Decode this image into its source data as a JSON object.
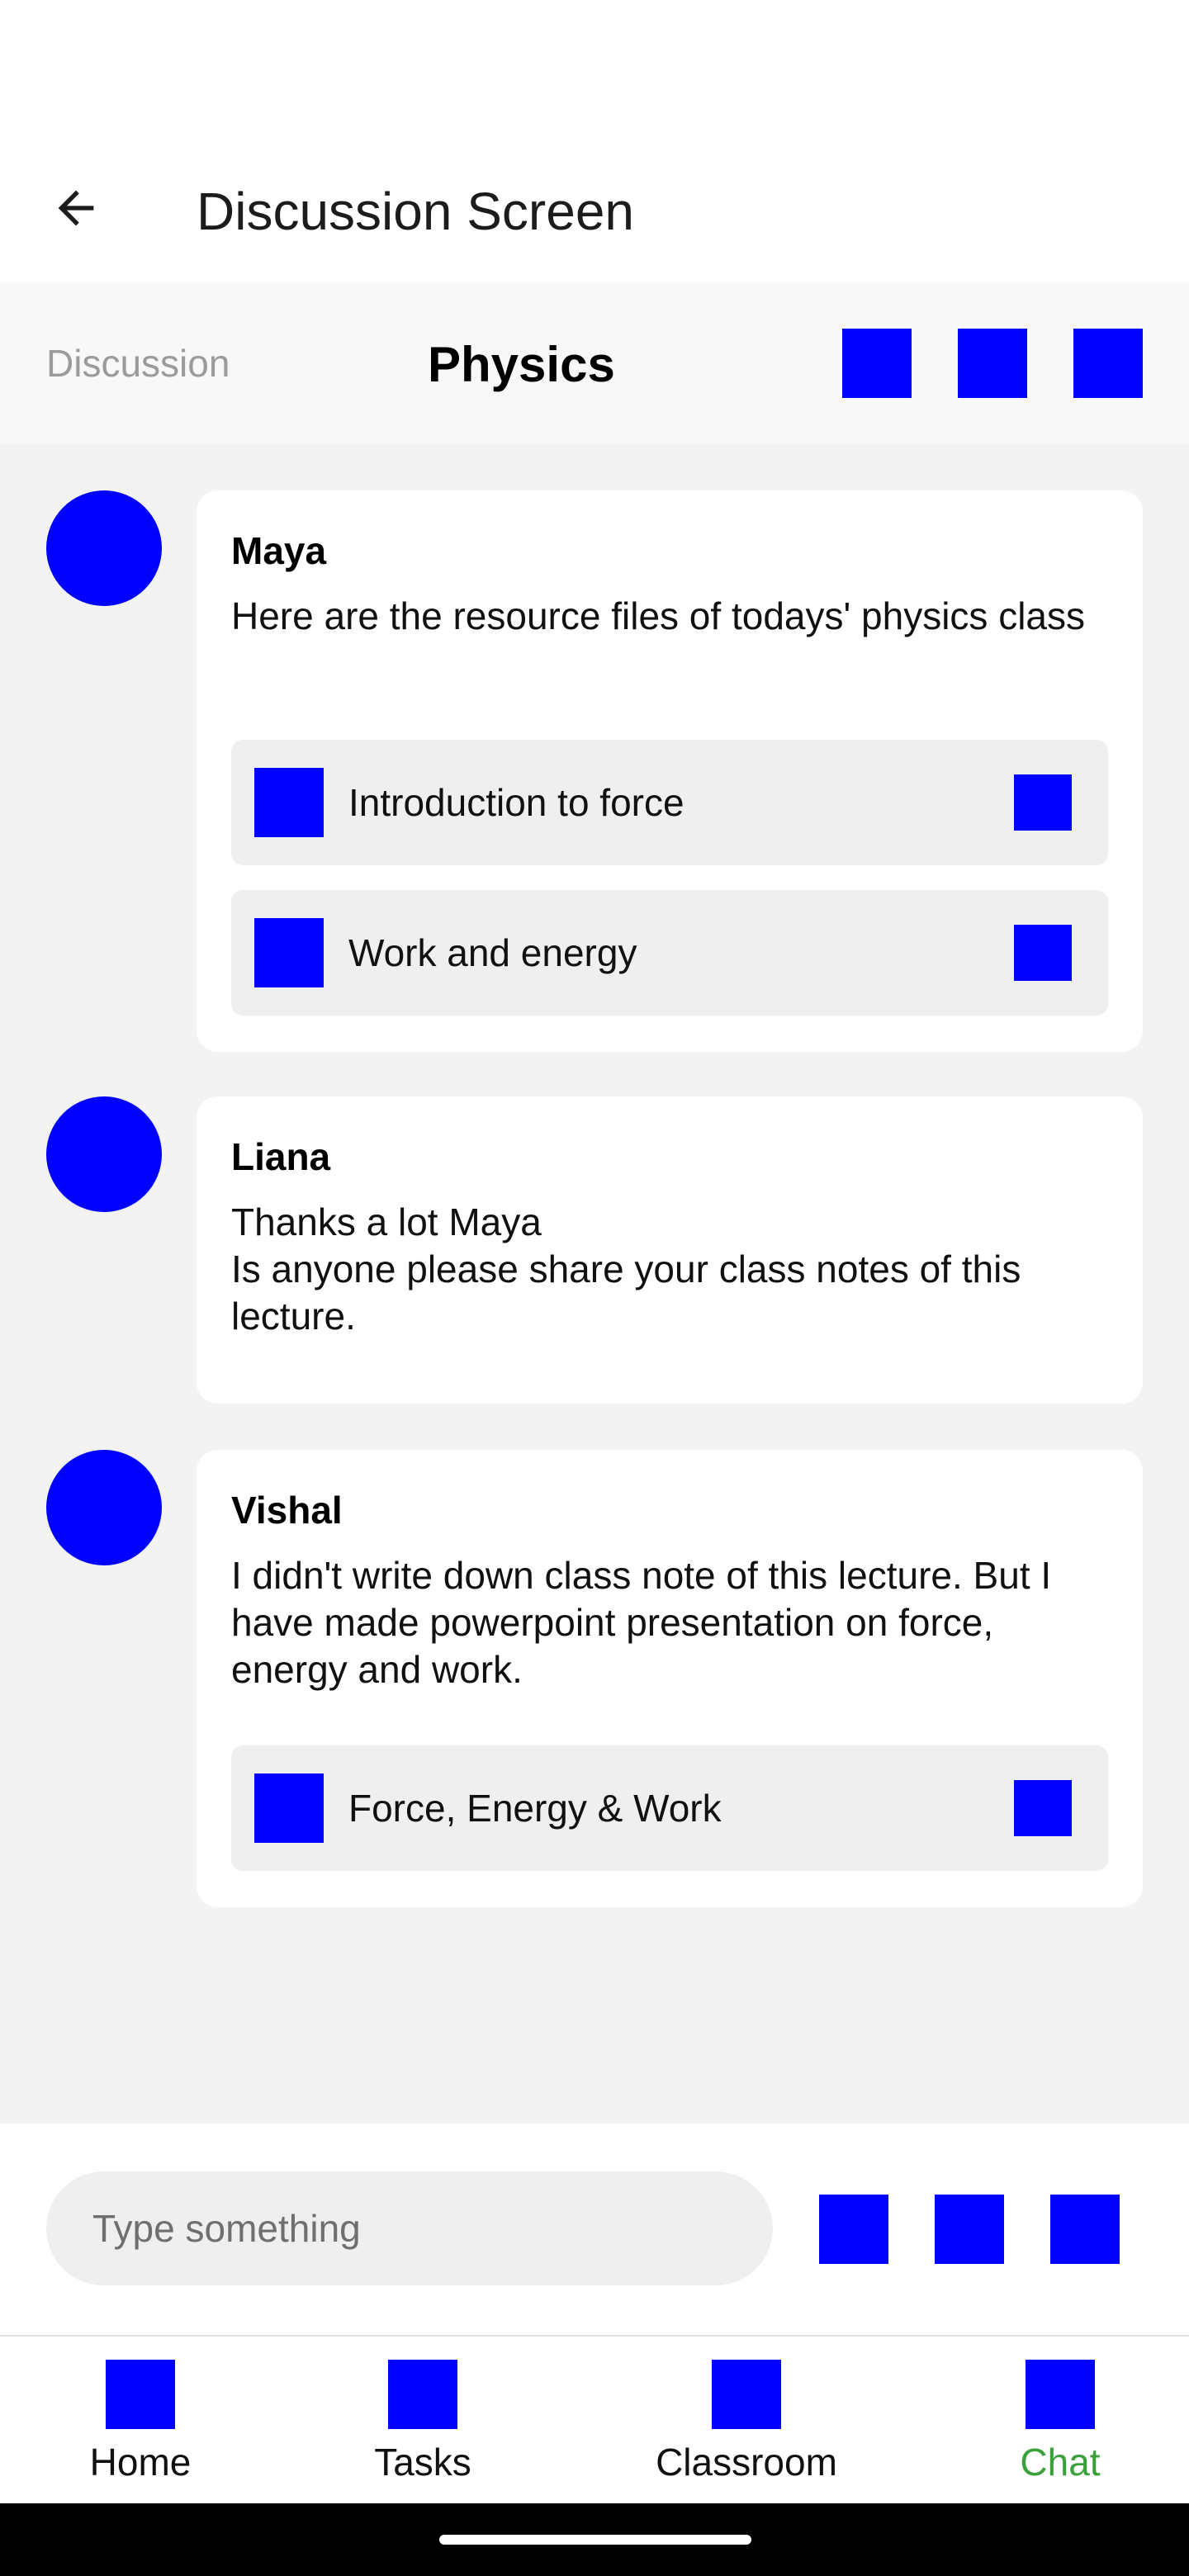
{
  "app_bar": {
    "title": "Discussion Screen",
    "back_icon": "arrow-left-icon"
  },
  "channel": {
    "crumb": "Discussion",
    "name": "Physics",
    "icons": [
      "placeholder-icon-1",
      "placeholder-icon-2",
      "placeholder-icon-3"
    ]
  },
  "messages": [
    {
      "author": "Maya",
      "text": "Here are the resource files of todays' physics class",
      "attachments": [
        {
          "name": "Introduction to force"
        },
        {
          "name": "Work and energy"
        }
      ]
    },
    {
      "author": "Liana",
      "text": "Thanks a lot Maya\nIs anyone please share your class notes of this lecture.",
      "attachments": []
    },
    {
      "author": "Vishal",
      "text": "I didn't write down class note of this lecture. But I have made powerpoint presentation on force, energy and work.",
      "attachments": [
        {
          "name": "Force, Energy & Work"
        }
      ]
    }
  ],
  "composer": {
    "placeholder": "Type something",
    "icons": [
      "attach-icon",
      "camera-icon",
      "send-icon"
    ]
  },
  "bottom_nav": [
    {
      "label": "Home",
      "active": false
    },
    {
      "label": "Tasks",
      "active": false
    },
    {
      "label": "Classroom",
      "active": false
    },
    {
      "label": "Chat",
      "active": true
    }
  ],
  "colors": {
    "placeholder_blue": "#0000ff",
    "active_nav": "#3aa13a"
  }
}
